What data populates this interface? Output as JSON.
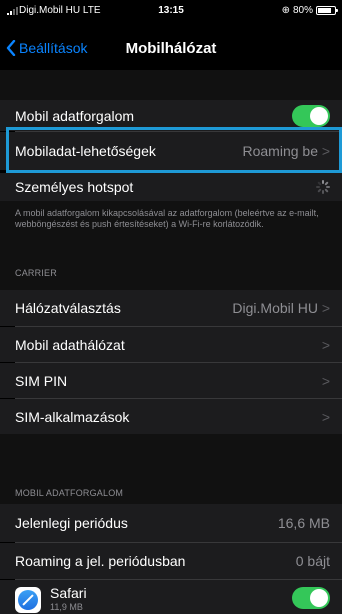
{
  "status_bar": {
    "carrier": "Digi.Mobil HU  LTE",
    "time": "13:15",
    "battery_text": "80%",
    "battery_level": 0.8
  },
  "nav": {
    "back_label": "Beállítások",
    "title": "Mobilhálózat"
  },
  "cellular_data": {
    "label": "Mobil adatforgalom",
    "enabled": true
  },
  "data_options": {
    "label": "Mobiladat-lehetőségek",
    "value": "Roaming be"
  },
  "hotspot": {
    "label": "Személyes hotspot"
  },
  "footnote": "A mobil adatforgalom kikapcsolásával az adatforgalom (beleértve az e-mailt, webböngészést és push értesítéseket) a Wi-Fi-re korlátozódik.",
  "carrier_section": {
    "header": "CARRIER",
    "items": [
      {
        "label": "Hálózatválasztás",
        "value": "Digi.Mobil HU"
      },
      {
        "label": "Mobil adathálózat",
        "value": ""
      },
      {
        "label": "SIM PIN",
        "value": ""
      },
      {
        "label": "SIM-alkalmazások",
        "value": ""
      }
    ]
  },
  "usage_section": {
    "header": "MOBIL ADATFORGALOM",
    "current_period": {
      "label": "Jelenlegi periódus",
      "value": "16,6 MB"
    },
    "roaming_period": {
      "label": "Roaming a jel. periódusban",
      "value": "0 bájt"
    }
  },
  "apps": [
    {
      "name": "Safari",
      "usage": "11,9 MB",
      "enabled": true,
      "icon": "safari-icon"
    }
  ],
  "colors": {
    "accent": "#0a84ff",
    "toggle_on": "#34c759",
    "highlight": "#1e9ad6"
  }
}
